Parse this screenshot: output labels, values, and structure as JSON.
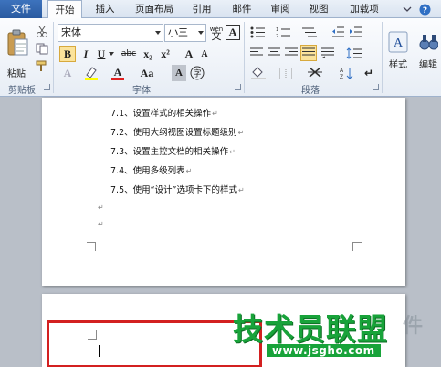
{
  "tabs": {
    "file": "文件",
    "home": "开始",
    "insert": "插入",
    "layout": "页面布局",
    "references": "引用",
    "mailings": "邮件",
    "review": "审阅",
    "view": "视图",
    "addins": "加载项"
  },
  "clipboard": {
    "paste_label": "粘贴",
    "group_label": "剪贴板"
  },
  "font": {
    "font_name": "宋体",
    "font_size": "小三",
    "group_label": "字体",
    "bold": "B",
    "italic": "I",
    "underline": "U",
    "strikethrough": "abc",
    "subscript": "x₂",
    "superscript": "x²",
    "grow": "A",
    "shrink": "A",
    "change_case": "Aa",
    "phonetic": "wén",
    "border_char": "A",
    "font_color": "A",
    "clear": "A",
    "enclose": "字"
  },
  "paragraph": {
    "group_label": "段落"
  },
  "styles": {
    "label": "样式"
  },
  "editing": {
    "label": "编辑"
  },
  "document": {
    "page1_lines": [
      "7.1、设置样式的相关操作",
      "7.2、使用大纲视图设置标题级别",
      "7.3、设置主控文档的相关操作",
      "7.4、使用多级列表",
      "7.5、使用“设计”选项卡下的样式"
    ],
    "para_mark": "↵"
  },
  "watermark": {
    "title": "技术员联盟",
    "url": "www.jsgho.com",
    "ghost": "件"
  },
  "colors": {
    "file_tab": "#2a5aa0",
    "highlight_border": "#d32020",
    "watermark_green": "#18a33a",
    "font_color_bar": "#e02020",
    "highlighter_bar": "#ffff00"
  }
}
